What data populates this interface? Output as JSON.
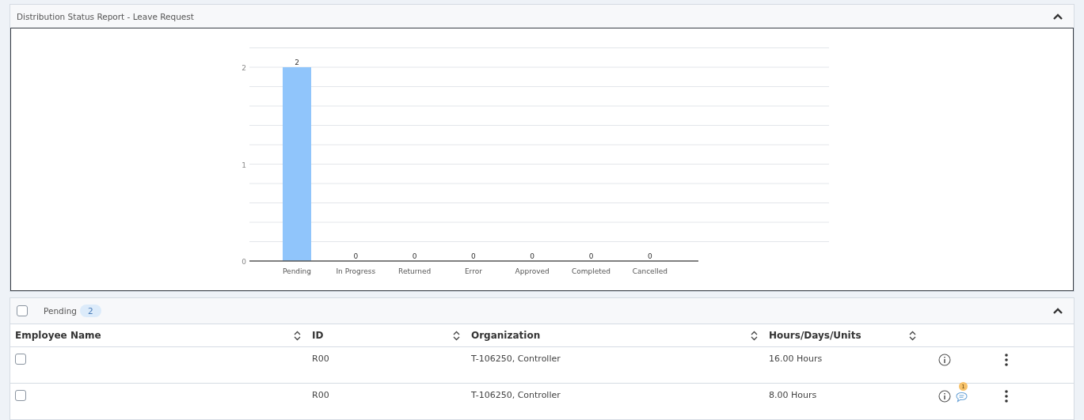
{
  "report_panel": {
    "title": "Distribution Status Report - Leave Request",
    "expanded": true,
    "chart_data": {
      "type": "bar",
      "categories": [
        "Pending",
        "In Progress",
        "Returned",
        "Error",
        "Approved",
        "Completed",
        "Cancelled"
      ],
      "series": [
        {
          "color": "#90c5fb",
          "values": [
            2,
            0,
            0,
            0,
            0,
            0,
            0
          ]
        }
      ],
      "ylim": [
        0,
        2.2
      ],
      "yticks": [
        0,
        1,
        2
      ],
      "data_labels": true
    }
  },
  "pending_panel": {
    "checked": false,
    "title": "Pending",
    "count": "2",
    "expanded": true,
    "table": {
      "columns": [
        "Employee Name",
        "ID",
        "Organization",
        "Hours/Days/Units"
      ],
      "rows": [
        {
          "checked": false,
          "id": "R00",
          "organization": "T-106250, Controller",
          "hours": "16.00 Hours"
        },
        {
          "checked": false,
          "id": "R00",
          "organization": "T-106250, Controller",
          "hours": "8.00 Hours",
          "comments": "1"
        }
      ]
    }
  }
}
